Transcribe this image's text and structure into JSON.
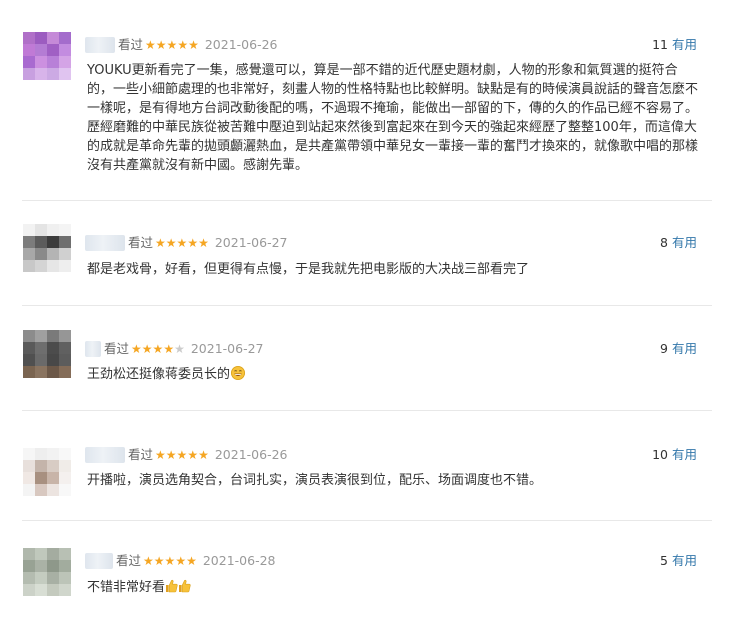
{
  "reviews": [
    {
      "watched_label": "看过",
      "rating": 5,
      "date": "2021-06-26",
      "votes": "11",
      "useful_label": "有用",
      "text": "YOUKU更新看完了一集，感覺還可以，算是一部不錯的近代歷史題材劇，人物的形象和氣質選的挺符合的，一些小細節處理的也非常好，刻畫人物的性格特點也比較鮮明。缺點是有的時候演員說話的聲音怎麼不一樣呢，是有得地方台詞改動後配的嗎，不過瑕不掩瑜，能做出一部留的下，傳的久的作品已經不容易了。歷經磨難的中華民族從被苦難中壓迫到站起來然後到富起來在到今天的強起來經歷了整整100年，而這偉大的成就是革命先輩的拋頭顱灑熱血，是共產黨帶領中華兒女一輩接一輩的奮鬥才換來的，就像歌中唱的那樣沒有共產黨就沒有新中國。感謝先輩。",
      "avatar_colors": [
        "#b070c8",
        "#9c5cc0",
        "#c58ad8",
        "#a46ccc",
        "#c07ad6",
        "#b47cd4",
        "#a060c4",
        "#c38ce0",
        "#a96ad0",
        "#cc90e0",
        "#b880d8",
        "#d4a4e6",
        "#c8a0e0",
        "#d8b4ea",
        "#ccaae4",
        "#e0c4f0"
      ]
    },
    {
      "watched_label": "看过",
      "rating": 5,
      "date": "2021-06-27",
      "votes": "8",
      "useful_label": "有用",
      "text": "都是老戏骨，好看，但更得有点慢，于是我就先把电影版的大决战三部看完了",
      "avatar_colors": [
        "#f2f2f2",
        "#e4e4e4",
        "#f0f0f0",
        "#f4f4f4",
        "#7c7c7c",
        "#5c5c5c",
        "#3c3c3c",
        "#6e6e6e",
        "#a8a8a8",
        "#8a8a8a",
        "#b4b4b4",
        "#d0d0d0",
        "#c8c8c8",
        "#d4d4d4",
        "#e6e6e6",
        "#eeeeee"
      ]
    },
    {
      "watched_label": "看过",
      "rating": 4,
      "date": "2021-06-27",
      "votes": "9",
      "useful_label": "有用",
      "text": "王劲松还挺像蒋委员长的",
      "emoji": "grin-emoji",
      "avatar_colors": [
        "#8c8c8c",
        "#a0a0a0",
        "#7a7a7a",
        "#969696",
        "#5a5a5a",
        "#6e6e6e",
        "#4c4c4c",
        "#606060",
        "#505050",
        "#6a6a6a",
        "#484848",
        "#5c5c5c",
        "#7a6450",
        "#8a7460",
        "#6c5848",
        "#846c58"
      ]
    },
    {
      "watched_label": "看过",
      "rating": 5,
      "date": "2021-06-26",
      "votes": "10",
      "useful_label": "有用",
      "text": "开播啦，演员选角契合，台词扎实，演员表演很到位，配乐、场面调度也不错。",
      "avatar_colors": [
        "#f6f6f6",
        "#eeeeee",
        "#f2f2f2",
        "#f8f8f8",
        "#e8e0dc",
        "#c4b4aa",
        "#d8ccc4",
        "#f0ece8",
        "#f0e8e4",
        "#a89080",
        "#c8b4a8",
        "#f4f0ee",
        "#f4f4f4",
        "#d8c8c0",
        "#ece4e0",
        "#f8f8f8"
      ]
    },
    {
      "watched_label": "看过",
      "rating": 5,
      "date": "2021-06-28",
      "votes": "5",
      "useful_label": "有用",
      "text": "不错非常好看",
      "emoji": "thumbs-up-emoji",
      "avatar_colors": [
        "#b0b8ac",
        "#c0c8bc",
        "#a4aca0",
        "#b8c0b4",
        "#98a294",
        "#aab2a6",
        "#8e988a",
        "#a2ac9e",
        "#b4bcb0",
        "#c4ccc0",
        "#a8b0a4",
        "#bcc4b8",
        "#ccd2c8",
        "#d8ded4",
        "#c4cabe",
        "#d0d6cc"
      ]
    }
  ]
}
